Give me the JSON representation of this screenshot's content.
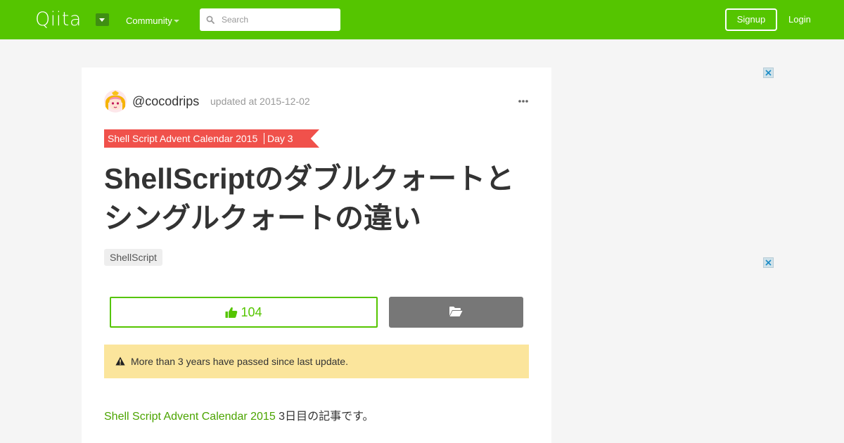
{
  "header": {
    "logo_text": "Qiita",
    "community_label": "Community",
    "search_placeholder": "Search",
    "signup_label": "Signup",
    "login_label": "Login",
    "brand_color": "#55c500"
  },
  "article": {
    "author": "@cocodrips",
    "updated": "updated at 2015-12-02",
    "calendar": {
      "name": "Shell Script Advent Calendar 2015",
      "day": "Day 3",
      "color": "#f0514b"
    },
    "title": "ShellScriptのダブルクォートとシングルクォートの違い",
    "tags": [
      "ShellScript"
    ],
    "like_count": "104",
    "alert_text": "More than 3 years have passed since last update.",
    "intro_link": "Shell Script Advent Calendar 2015",
    "intro_text": " 3日目の記事です。"
  },
  "icons": {
    "logo_menu": "caret-down-icon",
    "search": "search-icon",
    "more": "ellipsis-icon",
    "like": "thumbs-up-icon",
    "stock": "folder-open-icon",
    "alert": "warning-icon",
    "ad_close": "close-icon"
  }
}
